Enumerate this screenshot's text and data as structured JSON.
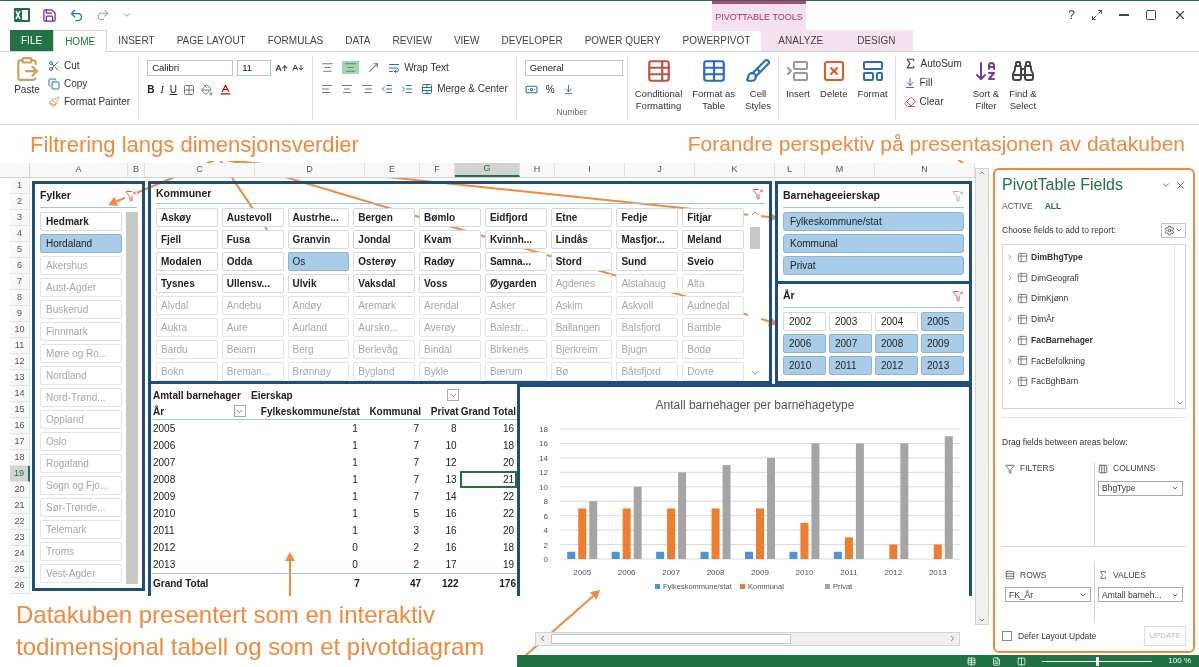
{
  "title_bar": {
    "context_group": "PIVOTTABLE TOOLS",
    "help": "?"
  },
  "ribbon_tabs": [
    {
      "label": "FILE",
      "kind": "file",
      "selected": false
    },
    {
      "label": "HOME",
      "kind": "normal",
      "selected": true
    },
    {
      "label": "INSERT",
      "kind": "normal",
      "selected": false
    },
    {
      "label": "PAGE LAYOUT",
      "kind": "normal",
      "selected": false
    },
    {
      "label": "FORMULAS",
      "kind": "normal",
      "selected": false
    },
    {
      "label": "DATA",
      "kind": "normal",
      "selected": false
    },
    {
      "label": "REVIEW",
      "kind": "normal",
      "selected": false
    },
    {
      "label": "VIEW",
      "kind": "normal",
      "selected": false
    },
    {
      "label": "DEVELOPER",
      "kind": "normal",
      "selected": false
    },
    {
      "label": "POWER QUERY",
      "kind": "normal",
      "selected": false
    },
    {
      "label": "POWERPIVOT",
      "kind": "normal",
      "selected": false
    },
    {
      "label": "ANALYZE",
      "kind": "context",
      "selected": false
    },
    {
      "label": "DESIGN",
      "kind": "context",
      "selected": false
    }
  ],
  "ribbon": {
    "clipboard": {
      "paste": "Paste",
      "cut": "Cut",
      "copy": "Copy",
      "format_painter": "Format Painter"
    },
    "font": {
      "name": "Calibri",
      "size": "11",
      "bold": "B",
      "italic": "I",
      "underline": "U"
    },
    "alignment": {
      "wrap_text": "Wrap Text",
      "merge": "Merge & Center"
    },
    "number": {
      "format": "General",
      "percent": "%",
      "label": "Number"
    },
    "styles": [
      "Conditional\nFormatting",
      "Format as\nTable",
      "Cell\nStyles"
    ],
    "cells": [
      "Insert",
      "Delete",
      "Format"
    ],
    "editing": {
      "autosum": "AutoSum",
      "fill": "Fill",
      "clear": "Clear",
      "sort": "Sort &\nFilter",
      "find": "Find &\nSelect"
    }
  },
  "annotations": {
    "top_left": "Filtrering langs dimensjonsverdier",
    "top_right": "Forandre perspektiv på presentasjonen av datakuben",
    "bottom": "Datakuben presentert som en interaktiv\ntodimensjonal tabell og som et pivotdiagram"
  },
  "columns": [
    {
      "label": "A",
      "selected": false
    },
    {
      "label": "B",
      "selected": false
    },
    {
      "label": "C",
      "selected": false
    },
    {
      "label": "D",
      "selected": false
    },
    {
      "label": "E",
      "selected": false
    },
    {
      "label": "F",
      "selected": false
    },
    {
      "label": "G",
      "selected": true
    },
    {
      "label": "H",
      "selected": false
    },
    {
      "label": "I",
      "selected": false
    },
    {
      "label": "J",
      "selected": false
    },
    {
      "label": "K",
      "selected": false
    },
    {
      "label": "L",
      "selected": false
    },
    {
      "label": "M",
      "selected": false
    },
    {
      "label": "N",
      "selected": false
    }
  ],
  "rows": [
    {
      "label": "1",
      "selected": false
    },
    {
      "label": "2",
      "selected": false
    },
    {
      "label": "3",
      "selected": false
    },
    {
      "label": "4",
      "selected": false
    },
    {
      "label": "5",
      "selected": false
    },
    {
      "label": "6",
      "selected": false
    },
    {
      "label": "7",
      "selected": false
    },
    {
      "label": "8",
      "selected": false
    },
    {
      "label": "9",
      "selected": false
    },
    {
      "label": "10",
      "selected": false
    },
    {
      "label": "11",
      "selected": false
    },
    {
      "label": "12",
      "selected": false
    },
    {
      "label": "13",
      "selected": false
    },
    {
      "label": "14",
      "selected": false
    },
    {
      "label": "15",
      "selected": false
    },
    {
      "label": "16",
      "selected": false
    },
    {
      "label": "17",
      "selected": false
    },
    {
      "label": "18",
      "selected": false
    },
    {
      "label": "19",
      "selected": true
    },
    {
      "label": "20",
      "selected": false
    },
    {
      "label": "21",
      "selected": false
    },
    {
      "label": "22",
      "selected": false
    },
    {
      "label": "23",
      "selected": false
    },
    {
      "label": "24",
      "selected": false
    },
    {
      "label": "25",
      "selected": false
    },
    {
      "label": "26",
      "selected": false
    }
  ],
  "fylker": {
    "title": "Fylker",
    "items": [
      {
        "label": "Hedmark",
        "selected": false,
        "has_data": true
      },
      {
        "label": "Hordaland",
        "selected": true,
        "has_data": true
      },
      {
        "label": "Akershus",
        "selected": false,
        "has_data": false
      },
      {
        "label": "Aust-Agder",
        "selected": false,
        "has_data": false
      },
      {
        "label": "Buskerud",
        "selected": false,
        "has_data": false
      },
      {
        "label": "Finnmark",
        "selected": false,
        "has_data": false
      },
      {
        "label": "Møre og Ro...",
        "selected": false,
        "has_data": false
      },
      {
        "label": "Nordland",
        "selected": false,
        "has_data": false
      },
      {
        "label": "Nord-Trønd...",
        "selected": false,
        "has_data": false
      },
      {
        "label": "Oppland",
        "selected": false,
        "has_data": false
      },
      {
        "label": "Oslo",
        "selected": false,
        "has_data": false
      },
      {
        "label": "Rogaland",
        "selected": false,
        "has_data": false
      },
      {
        "label": "Sogn og Fjo...",
        "selected": false,
        "has_data": false
      },
      {
        "label": "Sør-Trønde...",
        "selected": false,
        "has_data": false
      },
      {
        "label": "Telemark",
        "selected": false,
        "has_data": false
      },
      {
        "label": "Troms",
        "selected": false,
        "has_data": false
      },
      {
        "label": "Vest-Agder",
        "selected": false,
        "has_data": false
      }
    ]
  },
  "kommuner": {
    "title": "Kommuner",
    "items": [
      {
        "label": "Askøy",
        "selected": false,
        "has_data": true
      },
      {
        "label": "Austevoll",
        "selected": false,
        "has_data": true
      },
      {
        "label": "Austrhe...",
        "selected": false,
        "has_data": true
      },
      {
        "label": "Bergen",
        "selected": false,
        "has_data": true
      },
      {
        "label": "Bømlo",
        "selected": false,
        "has_data": true
      },
      {
        "label": "Eidfjord",
        "selected": false,
        "has_data": true
      },
      {
        "label": "Etne",
        "selected": false,
        "has_data": true
      },
      {
        "label": "Fedje",
        "selected": false,
        "has_data": true
      },
      {
        "label": "Fitjar",
        "selected": false,
        "has_data": true
      },
      {
        "label": "Fjell",
        "selected": false,
        "has_data": true
      },
      {
        "label": "Fusa",
        "selected": false,
        "has_data": true
      },
      {
        "label": "Granvin",
        "selected": false,
        "has_data": true
      },
      {
        "label": "Jondal",
        "selected": false,
        "has_data": true
      },
      {
        "label": "Kvam",
        "selected": false,
        "has_data": true
      },
      {
        "label": "Kvinnh...",
        "selected": false,
        "has_data": true
      },
      {
        "label": "Lindås",
        "selected": false,
        "has_data": true
      },
      {
        "label": "Masfjor...",
        "selected": false,
        "has_data": true
      },
      {
        "label": "Meland",
        "selected": false,
        "has_data": true
      },
      {
        "label": "Modalen",
        "selected": false,
        "has_data": true
      },
      {
        "label": "Odda",
        "selected": false,
        "has_data": true
      },
      {
        "label": "Os",
        "selected": true,
        "has_data": true
      },
      {
        "label": "Osterøy",
        "selected": false,
        "has_data": true
      },
      {
        "label": "Radøy",
        "selected": false,
        "has_data": true
      },
      {
        "label": "Samna...",
        "selected": false,
        "has_data": true
      },
      {
        "label": "Stord",
        "selected": false,
        "has_data": true
      },
      {
        "label": "Sund",
        "selected": false,
        "has_data": true
      },
      {
        "label": "Sveio",
        "selected": false,
        "has_data": true
      },
      {
        "label": "Tysnes",
        "selected": false,
        "has_data": true
      },
      {
        "label": "Ullensv...",
        "selected": false,
        "has_data": true
      },
      {
        "label": "Ulvik",
        "selected": false,
        "has_data": true
      },
      {
        "label": "Vaksdal",
        "selected": false,
        "has_data": true
      },
      {
        "label": "Voss",
        "selected": false,
        "has_data": true
      },
      {
        "label": "Øygarden",
        "selected": false,
        "has_data": true
      },
      {
        "label": "Agdenes",
        "selected": false,
        "has_data": false
      },
      {
        "label": "Alstahaug",
        "selected": false,
        "has_data": false
      },
      {
        "label": "Alta",
        "selected": false,
        "has_data": false
      },
      {
        "label": "Alvdal",
        "selected": false,
        "has_data": false
      },
      {
        "label": "Andebu",
        "selected": false,
        "has_data": false
      },
      {
        "label": "Andøy",
        "selected": false,
        "has_data": false
      },
      {
        "label": "Aremark",
        "selected": false,
        "has_data": false
      },
      {
        "label": "Arendal",
        "selected": false,
        "has_data": false
      },
      {
        "label": "Asker",
        "selected": false,
        "has_data": false
      },
      {
        "label": "Askim",
        "selected": false,
        "has_data": false
      },
      {
        "label": "Askvoll",
        "selected": false,
        "has_data": false
      },
      {
        "label": "Audnedal",
        "selected": false,
        "has_data": false
      },
      {
        "label": "Aukra",
        "selected": false,
        "has_data": false
      },
      {
        "label": "Aure",
        "selected": false,
        "has_data": false
      },
      {
        "label": "Aurland",
        "selected": false,
        "has_data": false
      },
      {
        "label": "Aursko...",
        "selected": false,
        "has_data": false
      },
      {
        "label": "Averøy",
        "selected": false,
        "has_data": false
      },
      {
        "label": "Balestr...",
        "selected": false,
        "has_data": false
      },
      {
        "label": "Ballangen",
        "selected": false,
        "has_data": false
      },
      {
        "label": "Balsfjord",
        "selected": false,
        "has_data": false
      },
      {
        "label": "Bamble",
        "selected": false,
        "has_data": false
      },
      {
        "label": "Bardu",
        "selected": false,
        "has_data": false
      },
      {
        "label": "Beiarn",
        "selected": false,
        "has_data": false
      },
      {
        "label": "Berg",
        "selected": false,
        "has_data": false
      },
      {
        "label": "Berlevåg",
        "selected": false,
        "has_data": false
      },
      {
        "label": "Bindal",
        "selected": false,
        "has_data": false
      },
      {
        "label": "Birkenes",
        "selected": false,
        "has_data": false
      },
      {
        "label": "Bjerkreim",
        "selected": false,
        "has_data": false
      },
      {
        "label": "Bjugn",
        "selected": false,
        "has_data": false
      },
      {
        "label": "Bodø",
        "selected": false,
        "has_data": false
      },
      {
        "label": "Bokn",
        "selected": false,
        "has_data": false
      },
      {
        "label": "Breman...",
        "selected": false,
        "has_data": false
      },
      {
        "label": "Brønnøy",
        "selected": false,
        "has_data": false
      },
      {
        "label": "Bygland",
        "selected": false,
        "has_data": false
      },
      {
        "label": "Bykle",
        "selected": false,
        "has_data": false
      },
      {
        "label": "Bærum",
        "selected": false,
        "has_data": false
      },
      {
        "label": "Bø",
        "selected": false,
        "has_data": false
      },
      {
        "label": "Båtsfjord",
        "selected": false,
        "has_data": false
      },
      {
        "label": "Dovre",
        "selected": false,
        "has_data": false
      }
    ]
  },
  "eierskap": {
    "title": "Barnehageeierskap",
    "items": [
      {
        "label": "Fylkeskommune/stat",
        "selected": true
      },
      {
        "label": "Kommunal",
        "selected": true
      },
      {
        "label": "Privat",
        "selected": true
      }
    ]
  },
  "aar": {
    "title": "År",
    "items": [
      {
        "label": "2002",
        "selected": false
      },
      {
        "label": "2003",
        "selected": false
      },
      {
        "label": "2004",
        "selected": false
      },
      {
        "label": "2005",
        "selected": true
      },
      {
        "label": "2006",
        "selected": true
      },
      {
        "label": "2007",
        "selected": true
      },
      {
        "label": "2008",
        "selected": true
      },
      {
        "label": "2009",
        "selected": true
      },
      {
        "label": "2010",
        "selected": true
      },
      {
        "label": "2011",
        "selected": true
      },
      {
        "label": "2012",
        "selected": true
      },
      {
        "label": "2013",
        "selected": true
      }
    ]
  },
  "pivot_table": {
    "value_field": "Amtall barnehager",
    "column_field": "Eierskap",
    "row_field": "År",
    "headers": [
      "Fylkeskommune/stat",
      "Kommunal",
      "Privat",
      "Grand Total"
    ],
    "rows": [
      {
        "label": "2005",
        "values": [
          "1",
          "7",
          "8",
          "16"
        ],
        "active": false
      },
      {
        "label": "2006",
        "values": [
          "1",
          "7",
          "10",
          "18"
        ],
        "active": false
      },
      {
        "label": "2007",
        "values": [
          "1",
          "7",
          "12",
          "20"
        ],
        "active": false
      },
      {
        "label": "2008",
        "values": [
          "1",
          "7",
          "13",
          "21"
        ],
        "active": true
      },
      {
        "label": "2009",
        "values": [
          "1",
          "7",
          "14",
          "22"
        ],
        "active": false
      },
      {
        "label": "2010",
        "values": [
          "1",
          "5",
          "16",
          "22"
        ],
        "active": false
      },
      {
        "label": "2011",
        "values": [
          "1",
          "3",
          "16",
          "20"
        ],
        "active": false
      },
      {
        "label": "2012",
        "values": [
          "0",
          "2",
          "16",
          "18"
        ],
        "active": false
      },
      {
        "label": "2013",
        "values": [
          "0",
          "2",
          "17",
          "19"
        ],
        "active": false
      }
    ],
    "total": {
      "label": "Grand Total",
      "values": [
        "7",
        "47",
        "122",
        "176"
      ]
    }
  },
  "chart": {
    "chart_data": {
      "type": "bar",
      "title": "Antall barnehager per barnehagetype",
      "categories": [
        "2005",
        "2006",
        "2007",
        "2008",
        "2009",
        "2010",
        "2011",
        "2012",
        "2013"
      ],
      "series": [
        {
          "name": "Fylkeskommune/stat",
          "color": "#4e93d8",
          "values": [
            1,
            1,
            1,
            1,
            1,
            1,
            1,
            0,
            0
          ]
        },
        {
          "name": "Kommunal",
          "color": "#f07c2c",
          "values": [
            7,
            7,
            7,
            7,
            7,
            5,
            3,
            2,
            2
          ]
        },
        {
          "name": "Privat",
          "color": "#a5a5a5",
          "values": [
            8,
            10,
            12,
            13,
            14,
            16,
            16,
            16,
            17
          ]
        }
      ],
      "ylim": [
        0,
        18
      ],
      "yticks": [
        0,
        2,
        4,
        6,
        8,
        10,
        12,
        14,
        16,
        18
      ],
      "grid": true,
      "legend": "bottom"
    }
  },
  "field_list": {
    "title": "PivotTable Fields",
    "tabs": [
      {
        "label": "ACTIVE",
        "selected": false
      },
      {
        "label": "ALL",
        "selected": true
      }
    ],
    "choose_label": "Choose fields to add to report:",
    "fields": [
      {
        "label": "DimBhgType",
        "in_use": true
      },
      {
        "label": "DimGeografi",
        "in_use": false
      },
      {
        "label": "DimKjønn",
        "in_use": false
      },
      {
        "label": "DimÅr",
        "in_use": false
      },
      {
        "label": "FacBarnehager",
        "in_use": true
      },
      {
        "label": "FacBefolkning",
        "in_use": false
      },
      {
        "label": "FacBghBarn",
        "in_use": false
      }
    ],
    "drag_label": "Drag fields between areas below:",
    "areas": [
      {
        "kind": "filters",
        "label": "FILTERS"
      },
      {
        "kind": "columns",
        "label": "COLUMNS",
        "items": [
          "BhgType"
        ]
      },
      {
        "kind": "rows",
        "label": "ROWS",
        "items": [
          "FK_År"
        ]
      },
      {
        "kind": "values",
        "label": "VALUES",
        "items": [
          "Amtall barneh..."
        ]
      }
    ],
    "defer": {
      "label": "Defer Layout Update",
      "checked": false
    },
    "update": {
      "label": "UPDATE",
      "disabled": true
    }
  },
  "status_bar": {
    "zoom": "100 %",
    "level": 0.5
  }
}
